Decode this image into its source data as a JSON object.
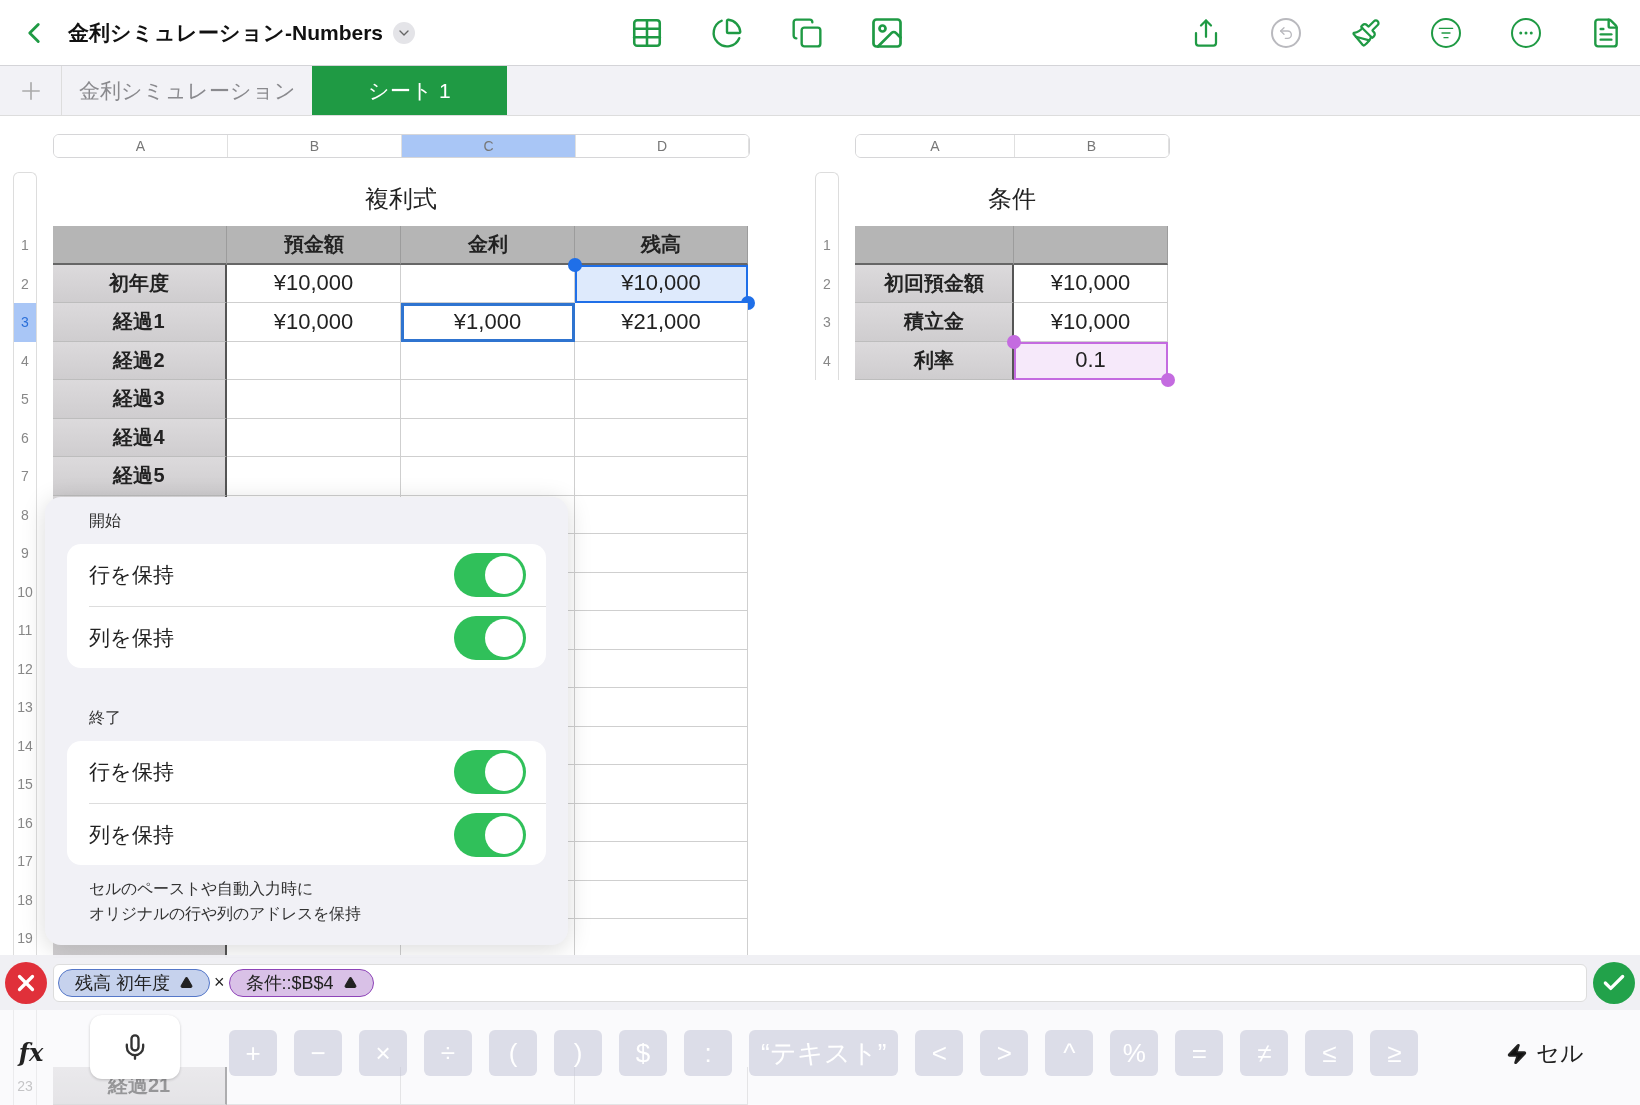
{
  "toolbar": {
    "title": "金利シミュレーション-Numbers",
    "center_tools": [
      {
        "kind": "table"
      },
      {
        "kind": "chart"
      },
      {
        "kind": "shape"
      },
      {
        "kind": "media"
      }
    ],
    "right_tools": [
      {
        "kind": "share",
        "disabled": false
      },
      {
        "kind": "undo",
        "disabled": true
      },
      {
        "kind": "brush",
        "disabled": false
      },
      {
        "kind": "organize",
        "disabled": false
      },
      {
        "kind": "more",
        "disabled": false
      },
      {
        "kind": "reader",
        "disabled": false
      }
    ]
  },
  "tabs": [
    {
      "label": "金利シミュレーション",
      "selected": false
    },
    {
      "label": "シート 1",
      "selected": true
    }
  ],
  "sheets": [
    {
      "title": "複利式",
      "columns": [
        {
          "letter": "A",
          "selected": false
        },
        {
          "letter": "B",
          "selected": false
        },
        {
          "letter": "C",
          "selected": true
        },
        {
          "letter": "D",
          "selected": false
        }
      ],
      "rows": [
        {
          "number": "1",
          "selected": false,
          "kind": "header",
          "cells": [
            {},
            {
              "text": "預金額"
            },
            {
              "text": "金利"
            },
            {
              "text": "残高"
            }
          ]
        },
        {
          "number": "2",
          "selected": false,
          "cells": [
            {
              "text": "初年度"
            },
            {
              "text": "¥10,000"
            },
            {},
            {
              "text": "¥10,000",
              "color": "#1f6fe8"
            }
          ]
        },
        {
          "number": "3",
          "selected": true,
          "cells": [
            {
              "text": "経過1"
            },
            {
              "text": "¥10,000"
            },
            {
              "text": "¥1,000",
              "editing": true
            },
            {
              "text": "¥21,000"
            }
          ]
        },
        {
          "number": "4",
          "selected": false,
          "cells": [
            {
              "text": "経過2"
            },
            {},
            {},
            {}
          ]
        },
        {
          "number": "5",
          "selected": false,
          "cells": [
            {
              "text": "経過3"
            },
            {},
            {},
            {}
          ]
        },
        {
          "number": "6",
          "selected": false,
          "cells": [
            {
              "text": "経過4"
            },
            {},
            {},
            {}
          ]
        },
        {
          "number": "7",
          "selected": false,
          "cells": [
            {
              "text": "経過5"
            },
            {},
            {},
            {}
          ]
        },
        {
          "number": "8",
          "selected": false,
          "cells": [
            {},
            {},
            {},
            {}
          ]
        },
        {
          "number": "9",
          "selected": false,
          "cells": [
            {},
            {},
            {},
            {}
          ]
        },
        {
          "number": "10",
          "selected": false,
          "cells": [
            {},
            {},
            {},
            {}
          ]
        },
        {
          "number": "11",
          "selected": false,
          "cells": [
            {},
            {},
            {},
            {}
          ]
        },
        {
          "number": "12",
          "selected": false,
          "cells": [
            {},
            {},
            {},
            {}
          ]
        },
        {
          "number": "13",
          "selected": false,
          "cells": [
            {},
            {},
            {},
            {}
          ]
        },
        {
          "number": "14",
          "selected": false,
          "cells": [
            {},
            {},
            {},
            {}
          ]
        },
        {
          "number": "15",
          "selected": false,
          "cells": [
            {},
            {},
            {},
            {}
          ]
        },
        {
          "number": "16",
          "selected": false,
          "cells": [
            {},
            {},
            {},
            {}
          ]
        },
        {
          "number": "17",
          "selected": false,
          "cells": [
            {},
            {},
            {},
            {}
          ]
        },
        {
          "number": "18",
          "selected": false,
          "cells": [
            {},
            {},
            {},
            {}
          ]
        },
        {
          "number": "19",
          "selected": false,
          "cells": [
            {},
            {},
            {},
            {}
          ]
        }
      ],
      "bottom_rows": [
        {
          "number": "23",
          "selected": false,
          "cells": [
            {
              "text": "経過21"
            },
            {},
            {},
            {}
          ]
        }
      ]
    },
    {
      "title": "条件",
      "columns": [
        {
          "letter": "A",
          "selected": false
        },
        {
          "letter": "B",
          "selected": false
        }
      ],
      "rows": [
        {
          "number": "1",
          "selected": false,
          "kind": "header",
          "cells": [
            {},
            {}
          ]
        },
        {
          "number": "2",
          "selected": false,
          "cells": [
            {
              "text": "初回預金額"
            },
            {
              "text": "¥10,000"
            }
          ]
        },
        {
          "number": "3",
          "selected": false,
          "cells": [
            {
              "text": "積立金"
            },
            {
              "text": "¥10,000"
            }
          ]
        },
        {
          "number": "4",
          "selected": false,
          "cells": [
            {
              "text": "利率"
            },
            {
              "text": "0.1",
              "color": "#c46be0"
            }
          ]
        }
      ]
    }
  ],
  "popover": {
    "sections": [
      {
        "title": "開始",
        "toggles": [
          {
            "label": "行を保持",
            "on": true
          },
          {
            "label": "列を保持",
            "on": true
          }
        ]
      },
      {
        "title": "終了",
        "toggles": [
          {
            "label": "行を保持",
            "on": true
          },
          {
            "label": "列を保持",
            "on": true
          }
        ]
      }
    ],
    "note_lines": [
      "セルのペーストや自動入力時に",
      "オリジナルの行や列のアドレスを保持"
    ]
  },
  "formula": {
    "tokens": [
      {
        "kind": "ref",
        "text": "残高 初年度",
        "color": "#5577c8"
      },
      {
        "kind": "op",
        "text": "×"
      },
      {
        "kind": "ref",
        "text": "条件::$B$4",
        "color": "#8e44b8"
      }
    ]
  },
  "keyboard": {
    "fx": "fx",
    "keys": [
      "+",
      "−",
      "×",
      "÷",
      "(",
      ")",
      "$",
      ":",
      "“テキスト”",
      "<",
      ">",
      "^",
      "%",
      "=",
      "≠",
      "≤",
      "≥"
    ],
    "cell_button": "セル"
  }
}
